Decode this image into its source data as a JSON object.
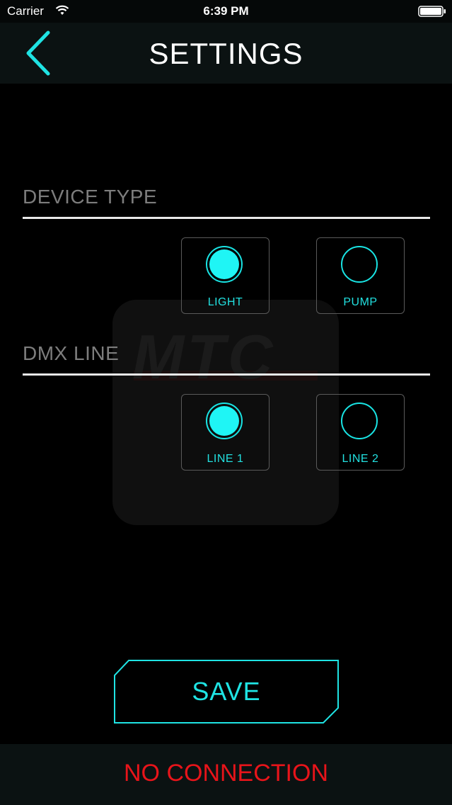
{
  "status_bar": {
    "carrier": "Carrier",
    "time": "6:39 PM",
    "wifi_icon": "wifi-icon",
    "battery_icon": "battery-icon"
  },
  "nav": {
    "title": "SETTINGS",
    "back_icon": "chevron-left-icon"
  },
  "watermark": {
    "text": "MTC"
  },
  "sections": [
    {
      "title": "DEVICE TYPE",
      "options": [
        {
          "label": "LIGHT",
          "selected": true
        },
        {
          "label": "PUMP",
          "selected": false
        }
      ]
    },
    {
      "title": "DMX LINE",
      "options": [
        {
          "label": "LINE 1",
          "selected": true
        },
        {
          "label": "LINE 2",
          "selected": false
        }
      ]
    }
  ],
  "save_button": {
    "label": "SAVE"
  },
  "footer": {
    "connection_status": "NO CONNECTION"
  },
  "colors": {
    "accent": "#1FE3E3",
    "error": "#E8141A",
    "background": "#000000",
    "bar": "#0B1212"
  }
}
